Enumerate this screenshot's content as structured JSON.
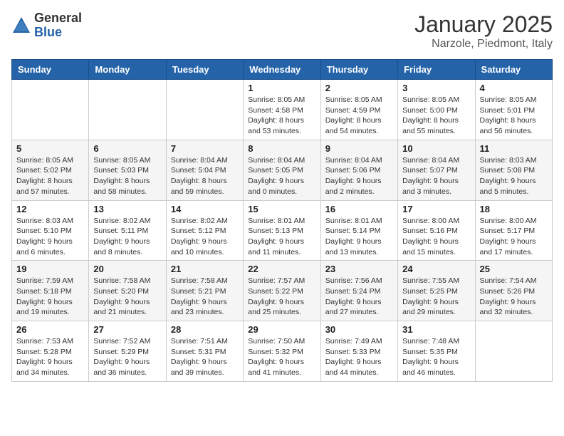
{
  "logo": {
    "general": "General",
    "blue": "Blue"
  },
  "title": "January 2025",
  "subtitle": "Narzole, Piedmont, Italy",
  "days_header": [
    "Sunday",
    "Monday",
    "Tuesday",
    "Wednesday",
    "Thursday",
    "Friday",
    "Saturday"
  ],
  "weeks": [
    [
      {
        "day": "",
        "info": ""
      },
      {
        "day": "",
        "info": ""
      },
      {
        "day": "",
        "info": ""
      },
      {
        "day": "1",
        "info": "Sunrise: 8:05 AM\nSunset: 4:58 PM\nDaylight: 8 hours\nand 53 minutes."
      },
      {
        "day": "2",
        "info": "Sunrise: 8:05 AM\nSunset: 4:59 PM\nDaylight: 8 hours\nand 54 minutes."
      },
      {
        "day": "3",
        "info": "Sunrise: 8:05 AM\nSunset: 5:00 PM\nDaylight: 8 hours\nand 55 minutes."
      },
      {
        "day": "4",
        "info": "Sunrise: 8:05 AM\nSunset: 5:01 PM\nDaylight: 8 hours\nand 56 minutes."
      }
    ],
    [
      {
        "day": "5",
        "info": "Sunrise: 8:05 AM\nSunset: 5:02 PM\nDaylight: 8 hours\nand 57 minutes."
      },
      {
        "day": "6",
        "info": "Sunrise: 8:05 AM\nSunset: 5:03 PM\nDaylight: 8 hours\nand 58 minutes."
      },
      {
        "day": "7",
        "info": "Sunrise: 8:04 AM\nSunset: 5:04 PM\nDaylight: 8 hours\nand 59 minutes."
      },
      {
        "day": "8",
        "info": "Sunrise: 8:04 AM\nSunset: 5:05 PM\nDaylight: 9 hours\nand 0 minutes."
      },
      {
        "day": "9",
        "info": "Sunrise: 8:04 AM\nSunset: 5:06 PM\nDaylight: 9 hours\nand 2 minutes."
      },
      {
        "day": "10",
        "info": "Sunrise: 8:04 AM\nSunset: 5:07 PM\nDaylight: 9 hours\nand 3 minutes."
      },
      {
        "day": "11",
        "info": "Sunrise: 8:03 AM\nSunset: 5:08 PM\nDaylight: 9 hours\nand 5 minutes."
      }
    ],
    [
      {
        "day": "12",
        "info": "Sunrise: 8:03 AM\nSunset: 5:10 PM\nDaylight: 9 hours\nand 6 minutes."
      },
      {
        "day": "13",
        "info": "Sunrise: 8:02 AM\nSunset: 5:11 PM\nDaylight: 9 hours\nand 8 minutes."
      },
      {
        "day": "14",
        "info": "Sunrise: 8:02 AM\nSunset: 5:12 PM\nDaylight: 9 hours\nand 10 minutes."
      },
      {
        "day": "15",
        "info": "Sunrise: 8:01 AM\nSunset: 5:13 PM\nDaylight: 9 hours\nand 11 minutes."
      },
      {
        "day": "16",
        "info": "Sunrise: 8:01 AM\nSunset: 5:14 PM\nDaylight: 9 hours\nand 13 minutes."
      },
      {
        "day": "17",
        "info": "Sunrise: 8:00 AM\nSunset: 5:16 PM\nDaylight: 9 hours\nand 15 minutes."
      },
      {
        "day": "18",
        "info": "Sunrise: 8:00 AM\nSunset: 5:17 PM\nDaylight: 9 hours\nand 17 minutes."
      }
    ],
    [
      {
        "day": "19",
        "info": "Sunrise: 7:59 AM\nSunset: 5:18 PM\nDaylight: 9 hours\nand 19 minutes."
      },
      {
        "day": "20",
        "info": "Sunrise: 7:58 AM\nSunset: 5:20 PM\nDaylight: 9 hours\nand 21 minutes."
      },
      {
        "day": "21",
        "info": "Sunrise: 7:58 AM\nSunset: 5:21 PM\nDaylight: 9 hours\nand 23 minutes."
      },
      {
        "day": "22",
        "info": "Sunrise: 7:57 AM\nSunset: 5:22 PM\nDaylight: 9 hours\nand 25 minutes."
      },
      {
        "day": "23",
        "info": "Sunrise: 7:56 AM\nSunset: 5:24 PM\nDaylight: 9 hours\nand 27 minutes."
      },
      {
        "day": "24",
        "info": "Sunrise: 7:55 AM\nSunset: 5:25 PM\nDaylight: 9 hours\nand 29 minutes."
      },
      {
        "day": "25",
        "info": "Sunrise: 7:54 AM\nSunset: 5:26 PM\nDaylight: 9 hours\nand 32 minutes."
      }
    ],
    [
      {
        "day": "26",
        "info": "Sunrise: 7:53 AM\nSunset: 5:28 PM\nDaylight: 9 hours\nand 34 minutes."
      },
      {
        "day": "27",
        "info": "Sunrise: 7:52 AM\nSunset: 5:29 PM\nDaylight: 9 hours\nand 36 minutes."
      },
      {
        "day": "28",
        "info": "Sunrise: 7:51 AM\nSunset: 5:31 PM\nDaylight: 9 hours\nand 39 minutes."
      },
      {
        "day": "29",
        "info": "Sunrise: 7:50 AM\nSunset: 5:32 PM\nDaylight: 9 hours\nand 41 minutes."
      },
      {
        "day": "30",
        "info": "Sunrise: 7:49 AM\nSunset: 5:33 PM\nDaylight: 9 hours\nand 44 minutes."
      },
      {
        "day": "31",
        "info": "Sunrise: 7:48 AM\nSunset: 5:35 PM\nDaylight: 9 hours\nand 46 minutes."
      },
      {
        "day": "",
        "info": ""
      }
    ]
  ]
}
